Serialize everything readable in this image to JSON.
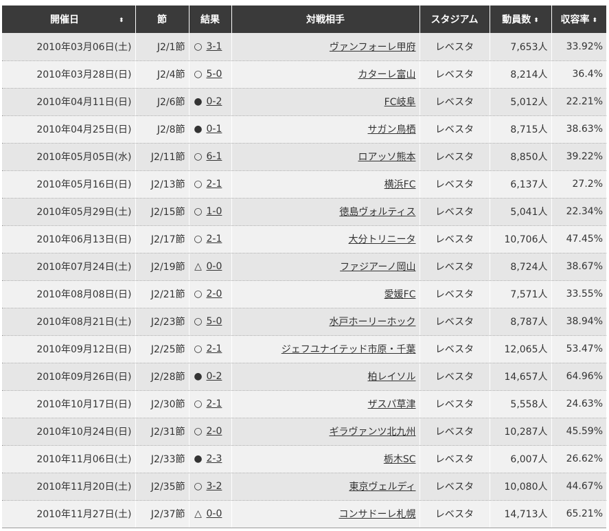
{
  "headers": {
    "date": "開催日",
    "section": "節",
    "result": "結果",
    "opponent": "対戦相手",
    "stadium": "スタジアム",
    "attendance": "動員数",
    "ratio": "収容率"
  },
  "sort_glyph": "⬍",
  "rows": [
    {
      "date": "2010年03月06日(土)",
      "section": "J2/1節",
      "mark": "○",
      "score": "3-1",
      "opponent": "ヴァンフォーレ甲府",
      "stadium": "レベスタ",
      "attendance": "7,653人",
      "ratio": "33.92%"
    },
    {
      "date": "2010年03月28日(日)",
      "section": "J2/4節",
      "mark": "○",
      "score": "5-0",
      "opponent": "カターレ富山",
      "stadium": "レベスタ",
      "attendance": "8,214人",
      "ratio": "36.4%"
    },
    {
      "date": "2010年04月11日(日)",
      "section": "J2/6節",
      "mark": "●",
      "score": "0-2",
      "opponent": "FC岐阜",
      "stadium": "レベスタ",
      "attendance": "5,012人",
      "ratio": "22.21%"
    },
    {
      "date": "2010年04月25日(日)",
      "section": "J2/8節",
      "mark": "●",
      "score": "0-1",
      "opponent": "サガン鳥栖",
      "stadium": "レベスタ",
      "attendance": "8,715人",
      "ratio": "38.63%"
    },
    {
      "date": "2010年05月05日(水)",
      "section": "J2/11節",
      "mark": "○",
      "score": "6-1",
      "opponent": "ロアッソ熊本",
      "stadium": "レベスタ",
      "attendance": "8,850人",
      "ratio": "39.22%"
    },
    {
      "date": "2010年05月16日(日)",
      "section": "J2/13節",
      "mark": "○",
      "score": "2-1",
      "opponent": "横浜FC",
      "stadium": "レベスタ",
      "attendance": "6,137人",
      "ratio": "27.2%"
    },
    {
      "date": "2010年05月29日(土)",
      "section": "J2/15節",
      "mark": "○",
      "score": "1-0",
      "opponent": "徳島ヴォルティス",
      "stadium": "レベスタ",
      "attendance": "5,041人",
      "ratio": "22.34%"
    },
    {
      "date": "2010年06月13日(日)",
      "section": "J2/17節",
      "mark": "○",
      "score": "2-1",
      "opponent": "大分トリニータ",
      "stadium": "レベスタ",
      "attendance": "10,706人",
      "ratio": "47.45%"
    },
    {
      "date": "2010年07月24日(土)",
      "section": "J2/19節",
      "mark": "△",
      "score": "0-0",
      "opponent": "ファジアーノ岡山",
      "stadium": "レベスタ",
      "attendance": "8,724人",
      "ratio": "38.67%"
    },
    {
      "date": "2010年08月08日(日)",
      "section": "J2/21節",
      "mark": "○",
      "score": "2-0",
      "opponent": "愛媛FC",
      "stadium": "レベスタ",
      "attendance": "7,571人",
      "ratio": "33.55%"
    },
    {
      "date": "2010年08月21日(土)",
      "section": "J2/23節",
      "mark": "○",
      "score": "5-0",
      "opponent": "水戸ホーリーホック",
      "stadium": "レベスタ",
      "attendance": "8,787人",
      "ratio": "38.94%"
    },
    {
      "date": "2010年09月12日(日)",
      "section": "J2/25節",
      "mark": "○",
      "score": "2-1",
      "opponent": "ジェフユナイテッド市原・千葉",
      "stadium": "レベスタ",
      "attendance": "12,065人",
      "ratio": "53.47%"
    },
    {
      "date": "2010年09月26日(日)",
      "section": "J2/28節",
      "mark": "●",
      "score": "0-2",
      "opponent": "柏レイソル",
      "stadium": "レベスタ",
      "attendance": "14,657人",
      "ratio": "64.96%"
    },
    {
      "date": "2010年10月17日(日)",
      "section": "J2/30節",
      "mark": "○",
      "score": "2-1",
      "opponent": "ザスパ草津",
      "stadium": "レベスタ",
      "attendance": "5,558人",
      "ratio": "24.63%"
    },
    {
      "date": "2010年10月24日(日)",
      "section": "J2/31節",
      "mark": "○",
      "score": "2-0",
      "opponent": "ギラヴァンツ北九州",
      "stadium": "レベスタ",
      "attendance": "10,287人",
      "ratio": "45.59%"
    },
    {
      "date": "2010年11月06日(土)",
      "section": "J2/33節",
      "mark": "●",
      "score": "2-3",
      "opponent": "栃木SC",
      "stadium": "レベスタ",
      "attendance": "6,007人",
      "ratio": "26.62%"
    },
    {
      "date": "2010年11月20日(土)",
      "section": "J2/35節",
      "mark": "○",
      "score": "3-2",
      "opponent": "東京ヴェルディ",
      "stadium": "レベスタ",
      "attendance": "10,080人",
      "ratio": "44.67%"
    },
    {
      "date": "2010年11月27日(土)",
      "section": "J2/37節",
      "mark": "△",
      "score": "0-0",
      "opponent": "コンサドーレ札幌",
      "stadium": "レベスタ",
      "attendance": "14,713人",
      "ratio": "65.21%"
    }
  ]
}
